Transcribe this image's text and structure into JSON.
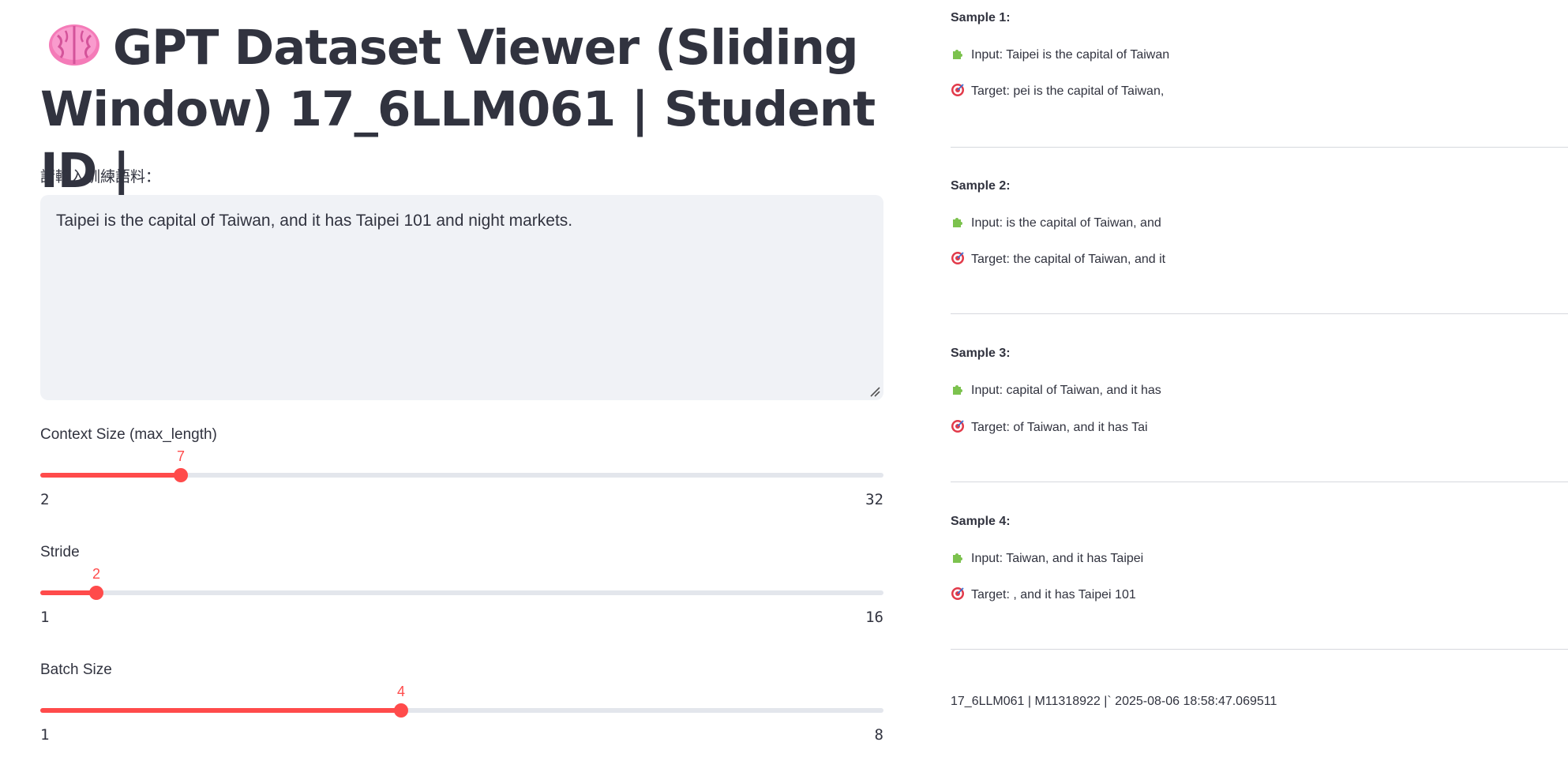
{
  "title": {
    "icon": "brain-icon",
    "text": "GPT Dataset Viewer (Sliding Window) 17_6LLM061 | Student ID |"
  },
  "corpus": {
    "label": "請輸入訓練語料：",
    "value": "Taipei is the capital of Taiwan, and it has Taipei 101 and night markets."
  },
  "sliders": {
    "context": {
      "label": "Context Size (max_length)",
      "value": "7",
      "min": "2",
      "max": "32"
    },
    "stride": {
      "label": "Stride",
      "value": "2",
      "min": "1",
      "max": "16"
    },
    "batch": {
      "label": "Batch Size",
      "value": "4",
      "min": "1",
      "max": "8"
    }
  },
  "samples": [
    {
      "title": "Sample 1:",
      "input": "Input: Taipei is the capital of Taiwan",
      "target": "Target: pei is the capital of Taiwan,"
    },
    {
      "title": "Sample 2:",
      "input": "Input: is the capital of Taiwan, and",
      "target": "Target: the capital of Taiwan, and it"
    },
    {
      "title": "Sample 3:",
      "input": "Input: capital of Taiwan, and it has",
      "target": "Target: of Taiwan, and it has Tai"
    },
    {
      "title": "Sample 4:",
      "input": "Input: Taiwan, and it has Taipei",
      "target": "Target: , and it has Taipei 101"
    }
  ],
  "icons": {
    "input": "puzzle-piece-icon",
    "target": "target-icon"
  },
  "footer": "17_6LLM061 | M11318922 |` 2025-08-06 18:58:47.069511",
  "colors": {
    "accent": "#ff4b4b",
    "input_bg": "#f0f2f6",
    "track": "#e3e6ec",
    "text": "#31333f"
  }
}
